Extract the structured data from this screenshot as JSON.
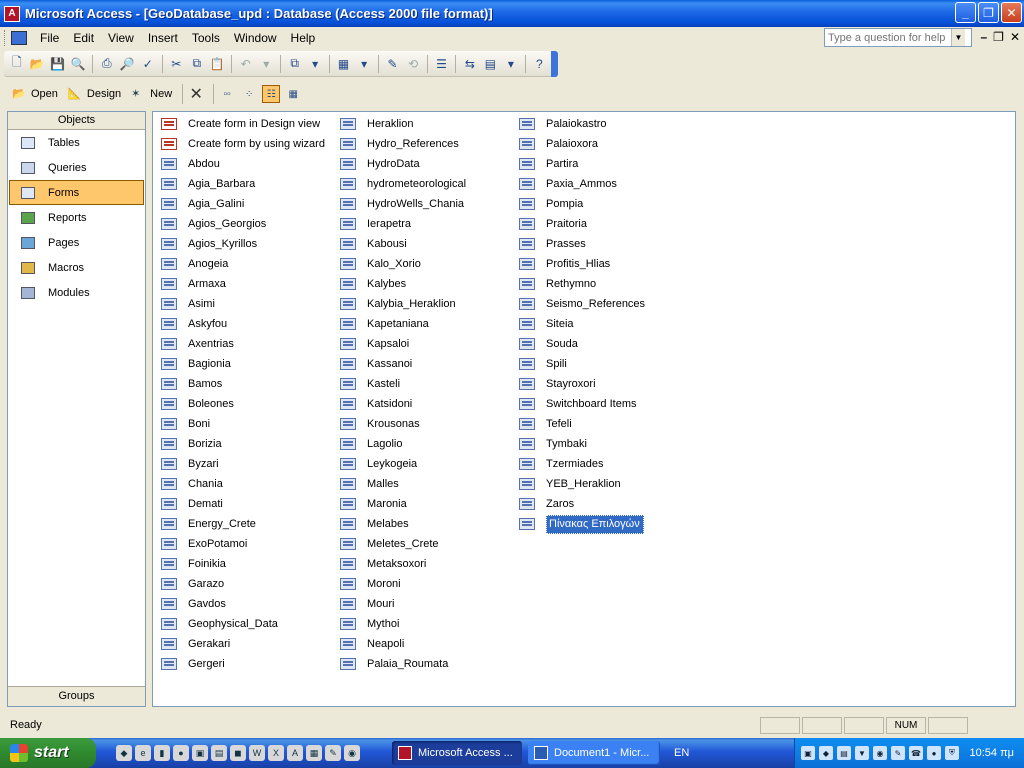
{
  "window": {
    "title": "Microsoft Access - [GeoDatabase_upd : Database (Access 2000 file format)]",
    "controls": [
      "_",
      "❐",
      "✕"
    ]
  },
  "menubar": {
    "items": [
      "File",
      "Edit",
      "View",
      "Insert",
      "Tools",
      "Window",
      "Help"
    ],
    "help_placeholder": "Type a question for help",
    "mdi_controls": [
      "–",
      "❐",
      "✕"
    ]
  },
  "db_toolbar": {
    "open": "Open",
    "design": "Design",
    "new": "New"
  },
  "objects": {
    "header": "Objects",
    "items": [
      "Tables",
      "Queries",
      "Forms",
      "Reports",
      "Pages",
      "Macros",
      "Modules"
    ],
    "selected": "Forms",
    "footer": "Groups"
  },
  "forms": {
    "col1": [
      "Create form in Design view",
      "Create form by using wizard",
      "Abdou",
      "Agia_Barbara",
      "Agia_Galini",
      "Agios_Georgios",
      "Agios_Kyrillos",
      "Anogeia",
      "Armaxa",
      "Asimi",
      "Askyfou",
      "Axentrias",
      "Bagionia",
      "Bamos",
      "Boleones",
      "Boni",
      "Borizia",
      "Byzari",
      "Chania",
      "Demati",
      "Energy_Crete",
      "ExoPotamoi",
      "Foinikia",
      "Garazo",
      "Gavdos",
      "Geophysical_Data",
      "Gerakari",
      "Gergeri"
    ],
    "col2": [
      "Heraklion",
      "Hydro_References",
      "HydroData",
      "hydrometeorological",
      "HydroWells_Chania",
      "Ierapetra",
      "Kabousi",
      "Kalo_Xorio",
      "Kalybes",
      "Kalybia_Heraklion",
      "Kapetaniana",
      "Kapsaloi",
      "Kassanoi",
      "Kasteli",
      "Katsidoni",
      "Krousonas",
      "Lagolio",
      "Leykogeia",
      "Malles",
      "Maronia",
      "Melabes",
      "Meletes_Crete",
      "Metaksoxori",
      "Moroni",
      "Mouri",
      "Mythoi",
      "Neapoli",
      "Palaia_Roumata"
    ],
    "col3": [
      "Palaiokastro",
      "Palaioxora",
      "Partira",
      "Paxia_Ammos",
      "Pompia",
      "Praitoria",
      "Prasses",
      "Profitis_Hlias",
      "Rethymno",
      "Seismo_References",
      "Siteia",
      "Souda",
      "Spili",
      "Stayroxori",
      "Switchboard Items",
      "Tefeli",
      "Tymbaki",
      "Tzermiades",
      "YEB_Heraklion",
      "Zaros",
      "Πίνακας Επιλογών"
    ],
    "selected": "Πίνακας Επιλογών"
  },
  "statusbar": {
    "text": "Ready",
    "num": "NUM"
  },
  "taskbar": {
    "start": "start",
    "tasks": [
      "Microsoft Access ...",
      "Document1 - Micr..."
    ],
    "lang": "EN",
    "clock": "10:54 πμ"
  }
}
